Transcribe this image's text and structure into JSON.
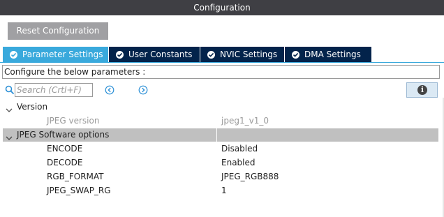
{
  "window": {
    "title": "Configuration"
  },
  "toolbar": {
    "reset_label": "Reset Configuration"
  },
  "tabs": [
    {
      "label": "Parameter Settings",
      "active": true
    },
    {
      "label": "User Constants",
      "active": false
    },
    {
      "label": "NVIC Settings",
      "active": false
    },
    {
      "label": "DMA Settings",
      "active": false
    }
  ],
  "description": "Configure the below parameters :",
  "search": {
    "placeholder": "Search (Crtl+F)",
    "value": ""
  },
  "groups": [
    {
      "label": "Version",
      "params": [
        {
          "name": "JPEG version",
          "value": "jpeg1_v1_0",
          "disabled": true
        }
      ]
    },
    {
      "label": "JPEG Software options",
      "params": [
        {
          "name": "ENCODE",
          "value": "Disabled",
          "disabled": false
        },
        {
          "name": "DECODE",
          "value": "Enabled",
          "disabled": false
        },
        {
          "name": "RGB_FORMAT",
          "value": "JPEG_RGB888",
          "disabled": false
        },
        {
          "name": "JPEG_SWAP_RG",
          "value": "1",
          "disabled": false
        }
      ]
    }
  ],
  "icons": {
    "search": "search-icon",
    "prev": "chevron-left-circle-icon",
    "next": "chevron-right-circle-icon",
    "info": "info-icon",
    "tab_check": "check-circle-icon",
    "expand": "chevron-down-icon"
  },
  "colors": {
    "titlebar": "#3f3f44",
    "tab_active": "#39a9dc",
    "tab_inactive": "#03234b",
    "highlight_row": "#c0c0c0",
    "button": "#a0a0a3"
  }
}
